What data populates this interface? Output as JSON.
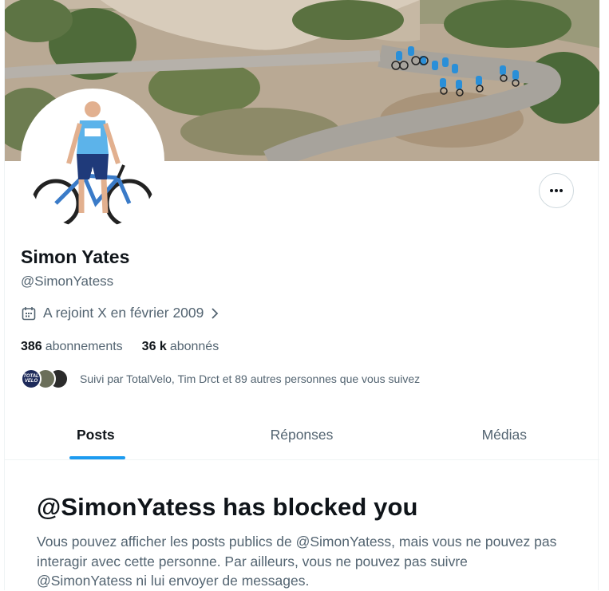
{
  "profile": {
    "name": "Simon Yates",
    "handle": "@SimonYatess",
    "joined": "A rejoint X en février 2009",
    "following_count": "386",
    "following_label": "abonnements",
    "followers_count": "36 k",
    "followers_label": "abonnés",
    "followed_by": "Suivi par TotalVelo, Tim Drct et 89 autres personnes que vous suivez",
    "mini_avatar_1_text": "TOTAL VELO"
  },
  "icons": {
    "more": "more-horizontal-icon",
    "calendar": "calendar-icon",
    "chevron": "chevron-right-icon"
  },
  "tabs": [
    {
      "label": "Posts",
      "active": true
    },
    {
      "label": "Réponses",
      "active": false
    },
    {
      "label": "Médias",
      "active": false
    }
  ],
  "blocked": {
    "title": "@SimonYatess has blocked you",
    "text": "Vous pouvez afficher les posts publics de @SimonYatess, mais vous ne pouvez pas interagir avec cette personne. Par ailleurs, vous ne pouvez pas suivre @SimonYatess ni lui envoyer de messages."
  },
  "colors": {
    "accent": "#1d9bf0",
    "text_primary": "#0f1419",
    "text_secondary": "#536471"
  }
}
